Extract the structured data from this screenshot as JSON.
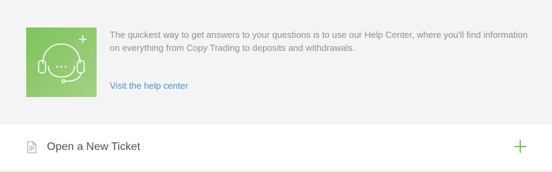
{
  "help_center": {
    "icon": "headset-support-icon",
    "description": "The quickest way to get answers to your questions is to use our Help Center, where you'll find information on everything from Copy Trading to deposits and withdrawals.",
    "link_label": "Visit the help center"
  },
  "ticket": {
    "label": "Open a New Ticket",
    "doc_icon": "document-icon",
    "action_icon": "plus-icon"
  },
  "colors": {
    "tile_gradient_start": "#7ec35a",
    "tile_gradient_end": "#a3d184",
    "link": "#4a90d6",
    "plus": "#6fbf3e",
    "panel_bg": "#f4f4f4"
  }
}
